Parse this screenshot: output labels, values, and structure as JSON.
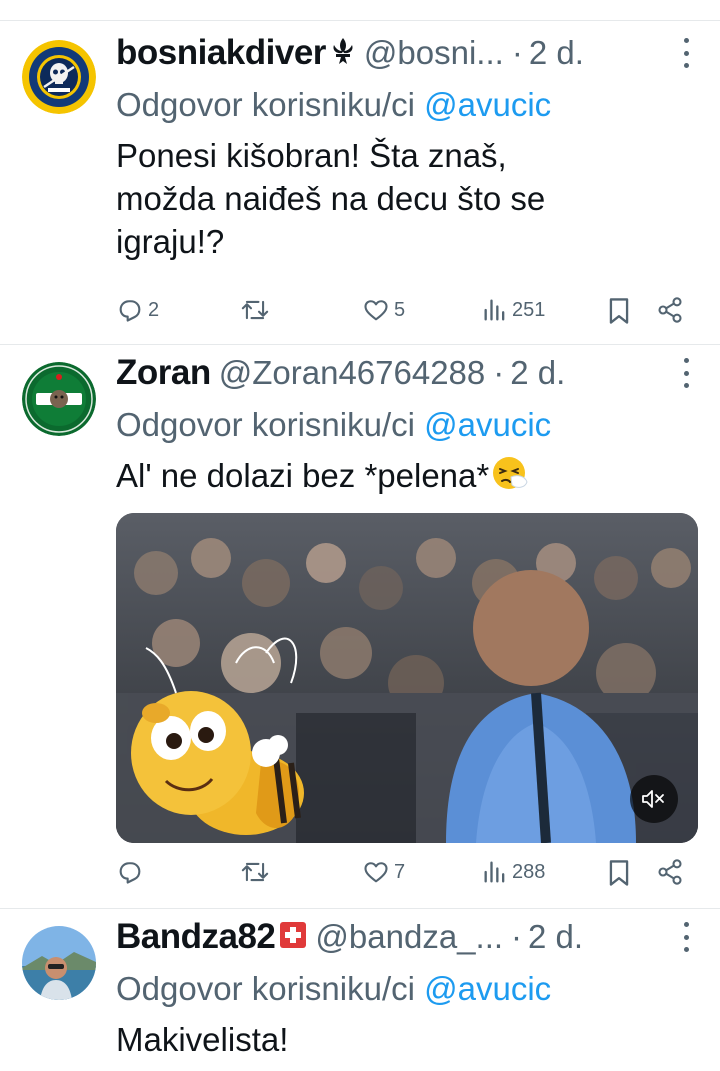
{
  "tweets": [
    {
      "name": "bosniakdiver",
      "name_badge": "fleur-de-lis-icon",
      "handle": "@bosni...",
      "dot": "·",
      "time": "2 d.",
      "reply_prefix": "Odgovor korisniku/ci",
      "reply_mention": "@avucic",
      "text_lines": [
        "Ponesi kišobran!  Šta znaš,",
        "možda naiđeš na decu što se",
        "igraju!?"
      ],
      "stats": {
        "replies": "2",
        "retweets": "",
        "likes": "5",
        "views": "251"
      }
    },
    {
      "name": "Zoran",
      "handle": "@Zoran46764288",
      "dot": "·",
      "time": "2 d.",
      "reply_prefix": "Odgovor korisniku/ci",
      "reply_mention": "@avucic",
      "text": "Al' ne dolazi bez *pelena*",
      "emoji": "sneezing-face",
      "media": {
        "type": "video",
        "muted": true
      },
      "stats": {
        "replies": "",
        "retweets": "",
        "likes": "7",
        "views": "288"
      }
    },
    {
      "name": "Bandza82",
      "name_badge": "swiss-flag-icon",
      "handle": "@bandza_...",
      "dot": "·",
      "time": "2 d.",
      "reply_prefix": "Odgovor korisniku/ci",
      "reply_mention": "@avucic",
      "text": "Makivelista!"
    }
  ],
  "colors": {
    "secondary_text": "#536471",
    "mention": "#1d9bf0",
    "divider": "#e6e9eb"
  }
}
